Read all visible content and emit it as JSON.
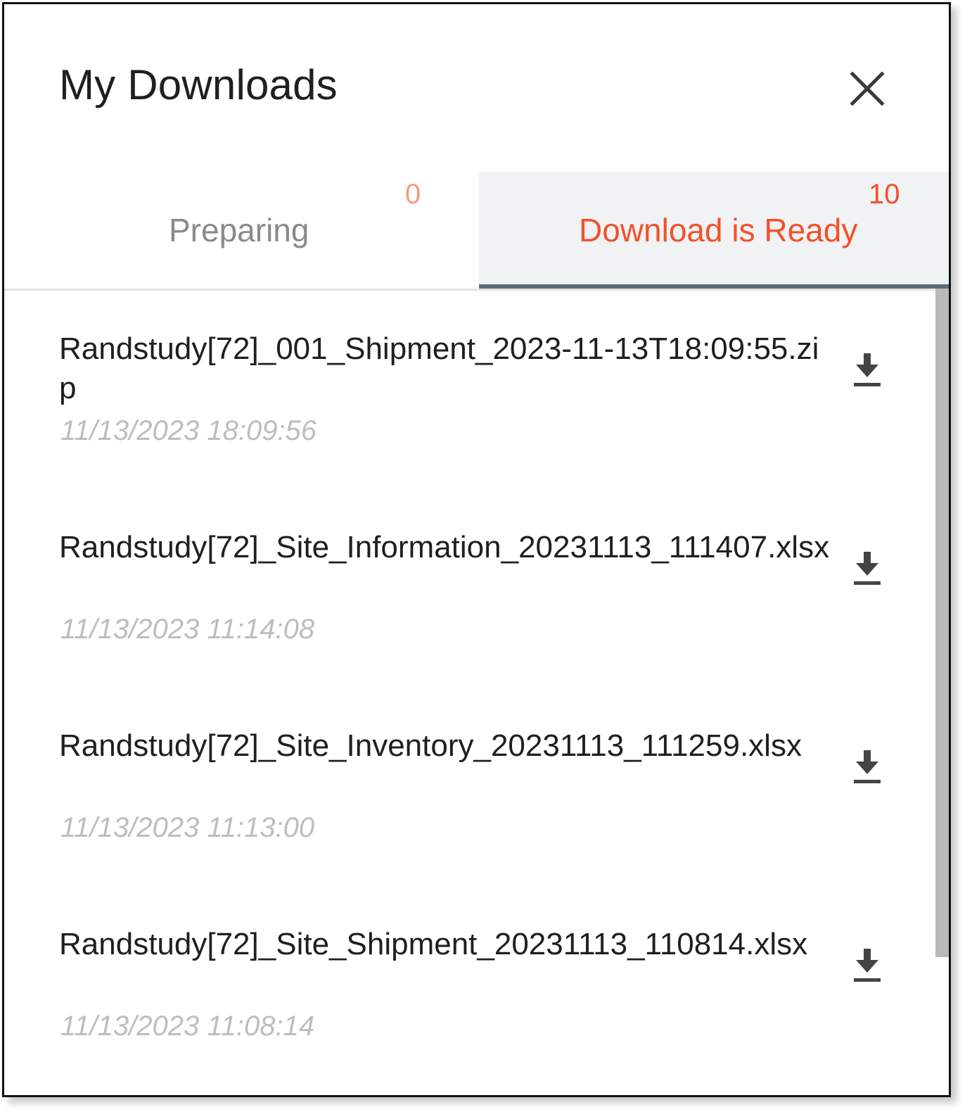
{
  "header": {
    "title": "My Downloads",
    "close_icon": "close-icon"
  },
  "tabs": {
    "preparing": {
      "label": "Preparing",
      "count": "0"
    },
    "ready": {
      "label": "Download is Ready",
      "count": "10"
    }
  },
  "colors": {
    "accent": "#f2512a",
    "accent_light": "#f59a7c",
    "active_tab_bg": "#f1f2f4",
    "active_tab_indicator": "#5b6b7a",
    "date_text": "#bdbdbd"
  },
  "downloads": [
    {
      "name": "Randstudy[72]_001_Shipment_2023-11-13T18:09:55.zip",
      "date": "11/13/2023 18:09:56",
      "icon": "download-icon"
    },
    {
      "name": "Randstudy[72]_Site_Information_20231113_111407.xlsx",
      "date": "11/13/2023 11:14:08",
      "icon": "download-icon"
    },
    {
      "name": "Randstudy[72]_Site_Inventory_20231113_111259.xlsx",
      "date": "11/13/2023 11:13:00",
      "icon": "download-icon"
    },
    {
      "name": "Randstudy[72]_Site_Shipment_20231113_110814.xlsx",
      "date": "11/13/2023 11:08:14",
      "icon": "download-icon"
    }
  ]
}
